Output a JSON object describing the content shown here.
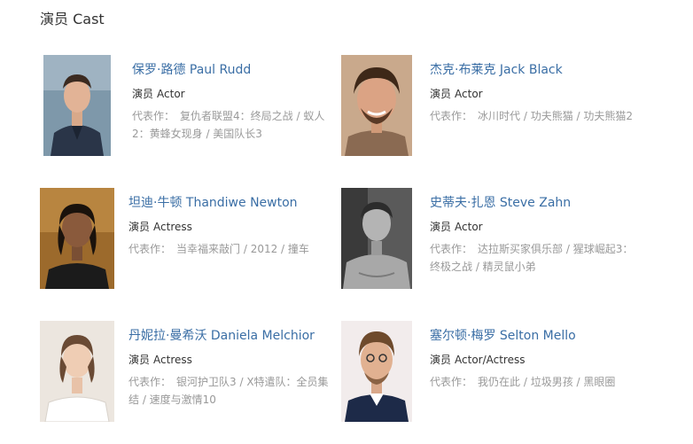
{
  "section": {
    "title": "演员 Cast"
  },
  "cast": [
    {
      "name": "保罗·路德 Paul Rudd",
      "role_prefix": "演员",
      "role": "Actor",
      "works_prefix": "代表作：",
      "works": "复仇者联盟4：终局之战 / 蚁人2：黄蜂女现身 / 美国队长3",
      "photo_icon": "headshot-paul-rudd"
    },
    {
      "name": "杰克·布莱克 Jack Black",
      "role_prefix": "演员",
      "role": "Actor",
      "works_prefix": "代表作：",
      "works": "冰川时代 / 功夫熊猫 / 功夫熊猫2",
      "photo_icon": "headshot-jack-black"
    },
    {
      "name": "坦迪·牛顿 Thandiwe Newton",
      "role_prefix": "演员",
      "role": "Actress",
      "works_prefix": "代表作：",
      "works": "当幸福来敲门 / 2012 / 撞车",
      "photo_icon": "headshot-thandiwe-newton"
    },
    {
      "name": "史蒂夫·扎恩 Steve Zahn",
      "role_prefix": "演员",
      "role": "Actor",
      "works_prefix": "代表作：",
      "works": "达拉斯买家俱乐部 / 猩球崛起3：终极之战 / 精灵鼠小弟",
      "photo_icon": "headshot-steve-zahn"
    },
    {
      "name": "丹妮拉·曼希沃 Daniela Melchior",
      "role_prefix": "演员",
      "role": "Actress",
      "works_prefix": "代表作：",
      "works": "银河护卫队3 / X特遣队：全员集结 / 速度与激情10",
      "photo_icon": "headshot-daniela-melchior"
    },
    {
      "name": "塞尔顿·梅罗 Selton Mello",
      "role_prefix": "演员",
      "role": "Actor/Actress",
      "works_prefix": "代表作：",
      "works": "我仍在此 / 垃圾男孩 / 黑眼圈",
      "photo_icon": "headshot-selton-mello"
    }
  ]
}
